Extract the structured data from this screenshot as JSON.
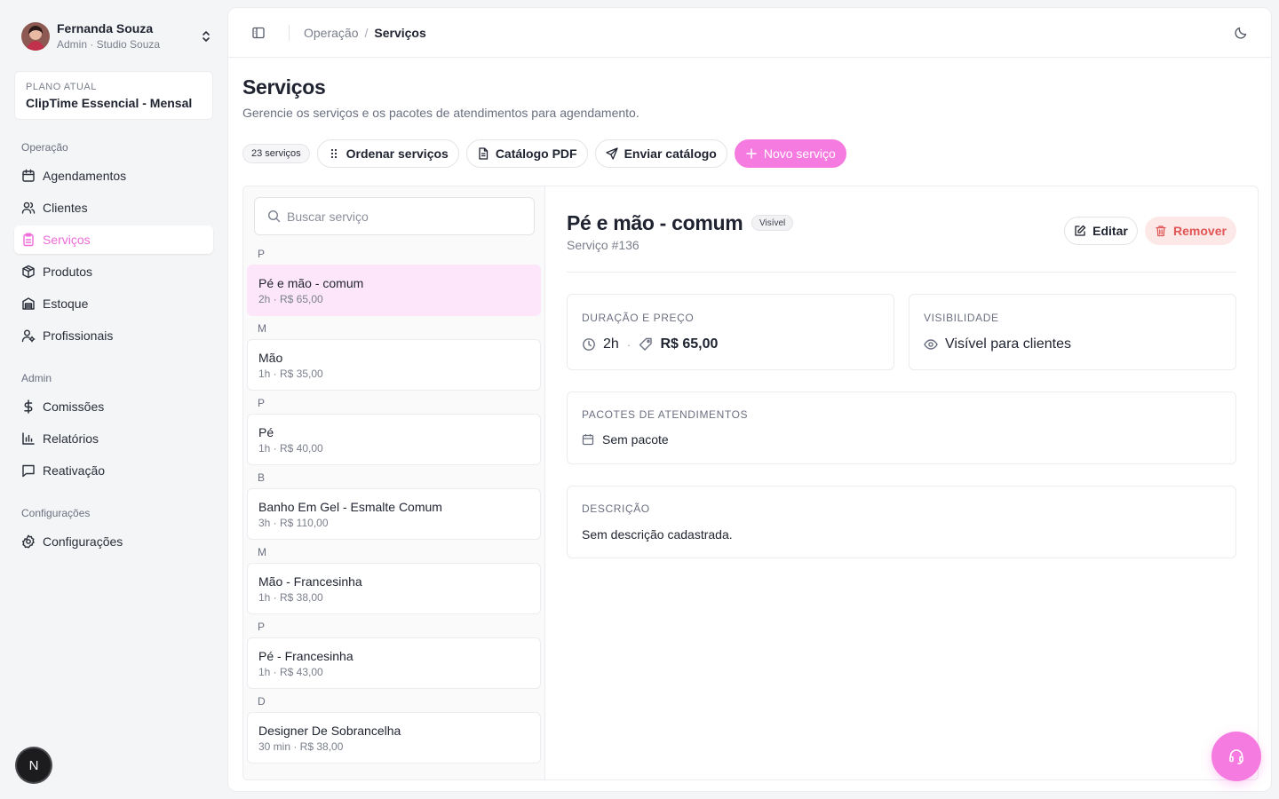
{
  "user": {
    "name": "Fernanda Souza",
    "role": "Admin · Studio Souza"
  },
  "plan": {
    "label": "PLANO ATUAL",
    "name": "ClipTime Essencial - Mensal"
  },
  "sidebar": {
    "sections": [
      {
        "title": "Operação",
        "items": [
          {
            "label": "Agendamentos",
            "icon": "calendar-icon"
          },
          {
            "label": "Clientes",
            "icon": "users-icon"
          },
          {
            "label": "Serviços",
            "icon": "clipboard-icon",
            "active": true
          },
          {
            "label": "Produtos",
            "icon": "package-icon"
          },
          {
            "label": "Estoque",
            "icon": "warehouse-icon"
          },
          {
            "label": "Profissionais",
            "icon": "user-cog-icon"
          }
        ]
      },
      {
        "title": "Admin",
        "items": [
          {
            "label": "Comissões",
            "icon": "dollar-icon"
          },
          {
            "label": "Relatórios",
            "icon": "bar-chart-icon"
          },
          {
            "label": "Reativação",
            "icon": "message-icon"
          }
        ]
      },
      {
        "title": "Configurações",
        "items": [
          {
            "label": "Configurações",
            "icon": "gear-icon"
          }
        ]
      }
    ]
  },
  "dev_badge": "N",
  "breadcrumb": {
    "parent": "Operação",
    "separator": "/",
    "current": "Serviços"
  },
  "page": {
    "title": "Serviços",
    "subtitle": "Gerencie os serviços e os pacotes de atendimentos para agendamento."
  },
  "toolbar": {
    "count": "23 serviços",
    "sort_label": "Ordenar serviços",
    "pdf_label": "Catálogo PDF",
    "send_label": "Enviar catálogo",
    "new_label": "Novo serviço"
  },
  "search": {
    "placeholder": "Buscar serviço",
    "value": ""
  },
  "services": [
    {
      "letter": "P",
      "name": "Pé e mão - comum",
      "meta": "2h · R$ 65,00",
      "selected": true
    },
    {
      "letter": "M",
      "name": "Mão",
      "meta": "1h · R$ 35,00"
    },
    {
      "letter": "P",
      "name": "Pé",
      "meta": "1h · R$ 40,00"
    },
    {
      "letter": "B",
      "name": "Banho Em Gel - Esmalte Comum",
      "meta": "3h · R$ 110,00"
    },
    {
      "letter": "M",
      "name": "Mão - Francesinha",
      "meta": "1h · R$ 38,00"
    },
    {
      "letter": "P",
      "name": "Pé - Francesinha",
      "meta": "1h · R$ 43,00"
    },
    {
      "letter": "D",
      "name": "Designer De Sobrancelha",
      "meta": "30 min · R$ 38,00"
    }
  ],
  "detail": {
    "title": "Pé e mão - comum",
    "badge": "Visível",
    "id": "Serviço #136",
    "edit_label": "Editar",
    "remove_label": "Remover",
    "duration_price": {
      "label": "DURAÇÃO E PREÇO",
      "duration": "2h",
      "separator": "·",
      "price": "R$ 65,00"
    },
    "visibility": {
      "label": "VISIBILIDADE",
      "value": "Visível para clientes"
    },
    "packages": {
      "label": "PACOTES DE ATENDIMENTOS",
      "value": "Sem pacote"
    },
    "description": {
      "label": "DESCRIÇÃO",
      "value": "Sem descrição cadastrada."
    }
  },
  "colors": {
    "accent": "#f57be0",
    "active_text": "#ef6bd8",
    "selected_bg": "#fde6fa",
    "danger": "#e05555",
    "danger_bg": "#fde8e8"
  }
}
